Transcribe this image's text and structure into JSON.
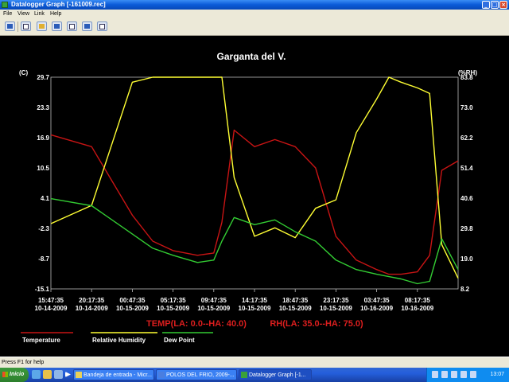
{
  "window": {
    "title": "Datalogger Graph [-161009.rec]",
    "buttons": [
      "_",
      "□",
      "×"
    ]
  },
  "menu": [
    "File",
    "View",
    "Link",
    "Help"
  ],
  "toolbar": {
    "icons": [
      "setup-icon",
      "monitor-icon",
      "open-folder-icon",
      "save-icon",
      "print-icon",
      "fit-graph-icon",
      "zoom-icon"
    ]
  },
  "chart_data": {
    "type": "line",
    "title": "Garganta del V.",
    "ylabel_left": "(C)",
    "ylabel_right": "(%RH)",
    "yticks_left": [
      "29.7",
      "23.3",
      "16.9",
      "10.5",
      "4.1",
      "-2.3",
      "-8.7",
      "-15.1"
    ],
    "yticks_right": [
      "83.8",
      "73.0",
      "62.2",
      "51.4",
      "40.6",
      "29.8",
      "19.0",
      "8.2"
    ],
    "ylim_left": [
      -15.1,
      29.7
    ],
    "ylim_right": [
      8.2,
      83.8
    ],
    "x_ticks": [
      {
        "time": "15:47:35",
        "date": "10-14-2009"
      },
      {
        "time": "20:17:35",
        "date": "10-14-2009"
      },
      {
        "time": "00:47:35",
        "date": "10-15-2009"
      },
      {
        "time": "05:17:35",
        "date": "10-15-2009"
      },
      {
        "time": "09:47:35",
        "date": "10-15-2009"
      },
      {
        "time": "14:17:35",
        "date": "10-15-2009"
      },
      {
        "time": "18:47:35",
        "date": "10-15-2009"
      },
      {
        "time": "23:17:35",
        "date": "10-15-2009"
      },
      {
        "time": "03:47:35",
        "date": "10-16-2009"
      },
      {
        "time": "08:17:35",
        "date": "10-16-2009"
      }
    ],
    "x": [
      0,
      1,
      2,
      2.5,
      3,
      3.6,
      4,
      4.2,
      4.5,
      5,
      5.5,
      6,
      6.5,
      7,
      7.5,
      8,
      8.3,
      8.6,
      9,
      9.3,
      9.6,
      10
    ],
    "series": [
      {
        "name": "Temperature",
        "color": "#c81414",
        "axis": "left",
        "values": [
          17.5,
          15.0,
          0.5,
          -5.0,
          -7.0,
          -8.0,
          -7.5,
          -1.0,
          18.5,
          15.0,
          16.5,
          15.0,
          10.5,
          -4.0,
          -9.0,
          -11.0,
          -12.0,
          -12.0,
          -11.5,
          -8.0,
          10.0,
          12.0
        ]
      },
      {
        "name": "Relative Humidity",
        "color": "#ffff33",
        "axis": "right",
        "values": [
          31.5,
          38.0,
          82.0,
          84.0,
          84.0,
          84.0,
          84.0,
          84.0,
          48.0,
          27.0,
          30.0,
          26.5,
          37.0,
          40.0,
          64.0,
          76.0,
          84.0,
          82.0,
          80.0,
          78.0,
          24.0,
          12.0
        ]
      },
      {
        "name": "Dew Point",
        "color": "#33cc33",
        "axis": "left",
        "values": [
          4.0,
          2.5,
          -3.5,
          -6.5,
          -8.0,
          -9.5,
          -9.0,
          -5.0,
          0.0,
          -1.5,
          -0.5,
          -3.0,
          -5.0,
          -9.0,
          -11.0,
          -12.0,
          -12.5,
          -13.0,
          -14.0,
          -13.5,
          -4.5,
          -11.0
        ]
      }
    ],
    "alarms": {
      "temp": "TEMP(LA: 0.0--HA: 40.0)",
      "rh": "RH(LA: 35.0--HA: 75.0)"
    },
    "legend": [
      {
        "label": "Temperature",
        "color": "#c81414"
      },
      {
        "label": "Relative Humidity",
        "color": "#ffff33"
      },
      {
        "label": "Dew Point",
        "color": "#33cc33"
      }
    ]
  },
  "status": "Press F1 for help",
  "taskbar": {
    "start_label": "Inicio",
    "tasks": [
      {
        "label": "Bandeja de entrada - Micr...",
        "active": false
      },
      {
        "label": "POLOS DEL FRIO, 2009-...",
        "active": false
      },
      {
        "label": "Datalogger Graph [-1...",
        "active": true
      }
    ],
    "clock": "13:07"
  }
}
